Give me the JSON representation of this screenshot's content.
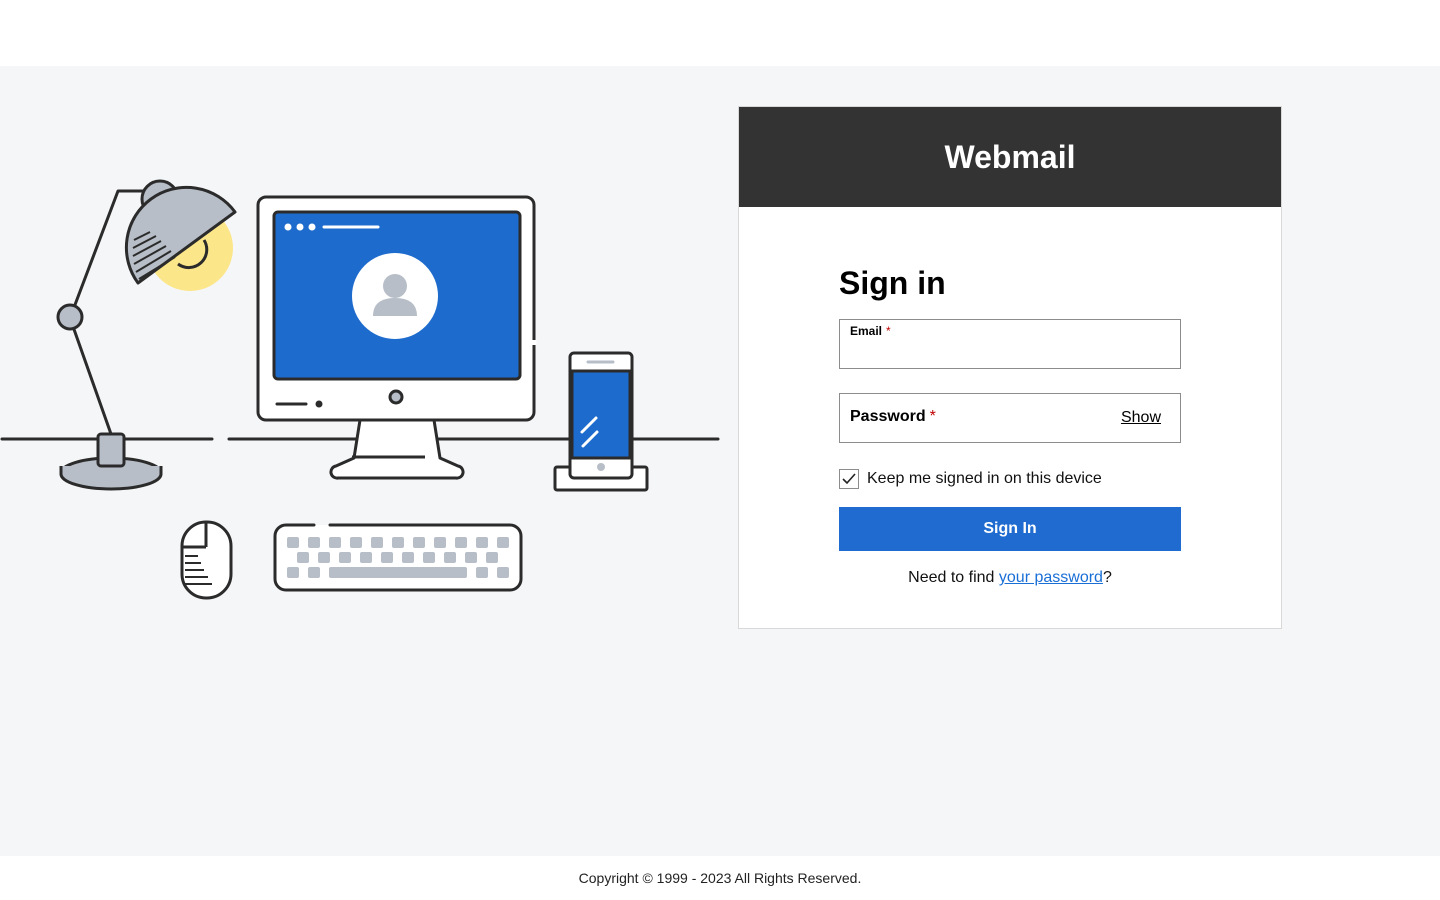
{
  "header": {
    "title": "Webmail"
  },
  "form": {
    "heading": "Sign in",
    "email_label": "Email",
    "email_value": "",
    "password_label": "Password",
    "password_value": "",
    "required_marker": "*",
    "show_label": "Show",
    "keep_signed_in_label": "Keep me signed in on this device",
    "keep_signed_in_checked": true,
    "submit_label": "Sign In",
    "find_prefix": "Need to find ",
    "find_link": "your password",
    "find_suffix": "?"
  },
  "footer": {
    "copyright": "Copyright © 1999 - 2023 All Rights Reserved."
  },
  "colors": {
    "header_bg": "#333333",
    "primary_button": "#1f6bd0",
    "link": "#1a6fd6",
    "page_bg": "#f5f6f8",
    "illustration_blue": "#1d6bcc",
    "lamp_glow": "#fce68a"
  },
  "illustration": {
    "icons": [
      "desk-lamp-icon",
      "monitor-icon",
      "user-avatar-icon",
      "smartphone-icon",
      "mouse-icon",
      "keyboard-icon"
    ]
  }
}
